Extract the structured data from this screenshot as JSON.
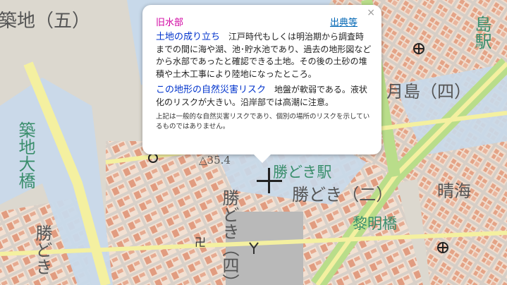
{
  "map": {
    "labels": {
      "ward_five": "築地（五）",
      "tsukishima_four": "月島（四）",
      "tsukishima_station": "島駅",
      "kachidoki_station": "勝どき駅",
      "kachidoki_two": "勝どき（二）",
      "harumi": "晴海",
      "reimei_bridge": "黎明橋",
      "tsukiji_ohashi": "築地大橋",
      "kachidoki_left": "勝どき",
      "kachidoki_mid": "勝どき（四）",
      "elevation": "△35.4",
      "partial_right": "（",
      "harumi_tail": "（"
    },
    "colors": {
      "land": "#dcd8cf",
      "block": "#f1e4d8",
      "building": "#e5a58a",
      "water_zone": "#c8d9ea",
      "road_major": "#f4f0a0",
      "road_green": "#b9dd8a",
      "text": "#555555",
      "station_text": "#3a8e6c"
    }
  },
  "popup": {
    "title": "旧水部",
    "source_link": "出典等",
    "close": "×",
    "section1_heading": "土地の成り立ち",
    "section1_text": "江戸時代もしくは明治期から調査時までの間に海や湖、池･貯水池であり、過去の地形図などから水部であったと確認できる土地。その後の土砂の堆積や土木工事により陸地になったところ。",
    "section2_heading": "この地形の自然災害リスク",
    "section2_text": "地盤が軟弱である。液状化のリスクが大きい。沿岸部では高潮に注意。",
    "note": "上記は一般的な自然災害リスクであり、個別の場所のリスクを示しているものではありません。"
  }
}
